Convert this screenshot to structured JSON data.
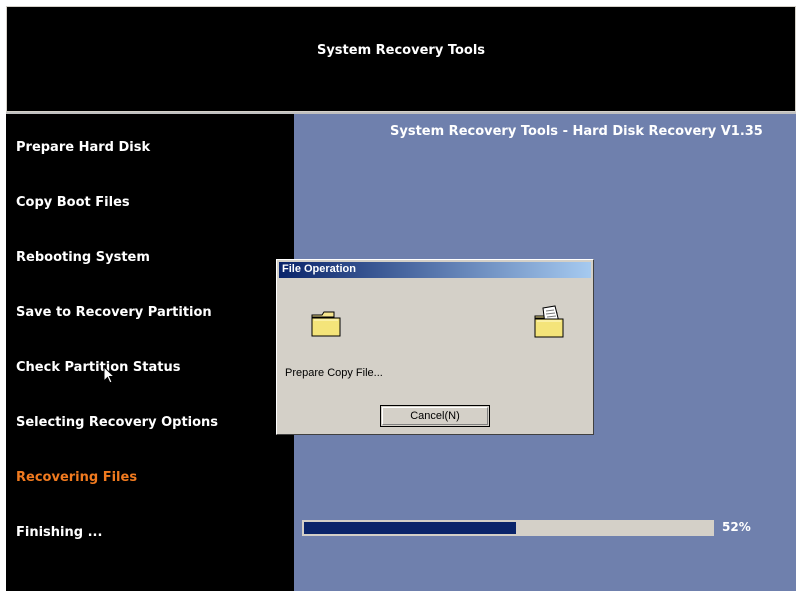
{
  "header": {
    "title": "System Recovery Tools"
  },
  "sidebar": {
    "steps": [
      {
        "label": "Prepare Hard Disk",
        "active": false
      },
      {
        "label": "Copy Boot Files",
        "active": false
      },
      {
        "label": "Rebooting System",
        "active": false
      },
      {
        "label": "Save to Recovery Partition",
        "active": false
      },
      {
        "label": "Check Partition Status",
        "active": false
      },
      {
        "label": "Selecting Recovery Options",
        "active": false
      },
      {
        "label": "Recovering Files",
        "active": true
      },
      {
        "label": "Finishing ...",
        "active": false
      }
    ]
  },
  "main": {
    "title": "System Recovery Tools - Hard Disk Recovery V1.35",
    "progress": {
      "value": 0.52,
      "label": "52%"
    }
  },
  "dialog": {
    "title": "File Operation",
    "message": "Prepare Copy File...",
    "cancel_label": "Cancel(N)",
    "icons": [
      "folder-icon",
      "folder-with-document-icon"
    ]
  },
  "colors": {
    "background": "#000000",
    "main_panel": "#6f80ad",
    "active_step": "#f07a1f",
    "progress_fill": "#0a246a",
    "dialog_face": "#d4d0c8"
  }
}
